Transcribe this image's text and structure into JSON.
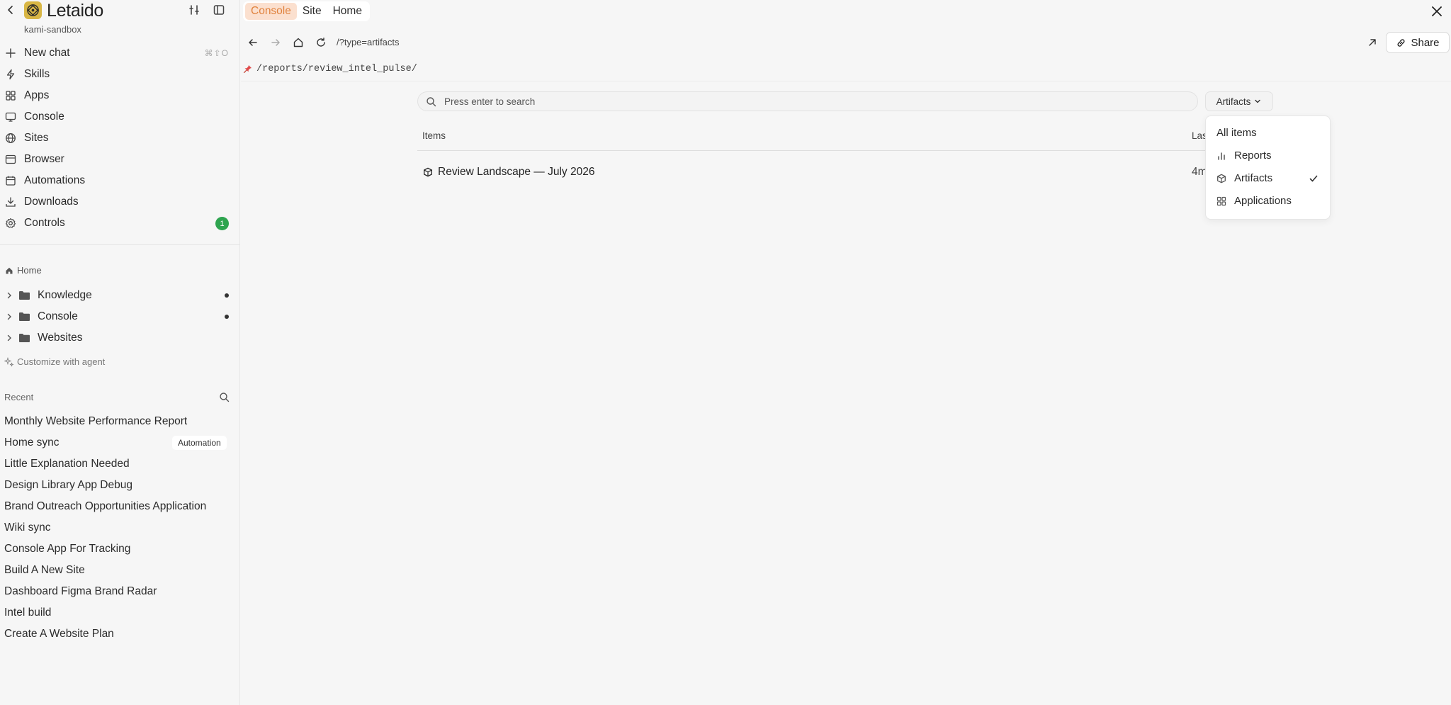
{
  "sidebar": {
    "brand": "Letaido",
    "workspace": "kami-sandbox",
    "nav": [
      {
        "label": "New chat",
        "icon": "plus-icon",
        "shortcut": "⌘⇧O"
      },
      {
        "label": "Skills",
        "icon": "bolt-icon"
      },
      {
        "label": "Apps",
        "icon": "grid-icon"
      },
      {
        "label": "Console",
        "icon": "monitor-icon"
      },
      {
        "label": "Sites",
        "icon": "globe-icon"
      },
      {
        "label": "Browser",
        "icon": "browser-icon"
      },
      {
        "label": "Automations",
        "icon": "calendar-icon"
      },
      {
        "label": "Downloads",
        "icon": "download-icon"
      },
      {
        "label": "Controls",
        "icon": "gear-icon",
        "badge": "1"
      }
    ],
    "home_label": "Home",
    "tree": [
      {
        "label": "Knowledge"
      },
      {
        "label": "Console"
      },
      {
        "label": "Websites"
      }
    ],
    "customize_label": "Customize with agent",
    "recent_label": "Recent",
    "recent": [
      {
        "label": "Monthly Website Performance Report"
      },
      {
        "label": "Home sync",
        "tag": "Automation"
      },
      {
        "label": "Little Explanation Needed"
      },
      {
        "label": "Design Library App Debug"
      },
      {
        "label": "Brand Outreach Opportunities Application"
      },
      {
        "label": "Wiki sync"
      },
      {
        "label": "Console App For Tracking"
      },
      {
        "label": "Build A New Site"
      },
      {
        "label": "Dashboard Figma Brand Radar"
      },
      {
        "label": "Intel build"
      },
      {
        "label": "Create A Website Plan"
      }
    ]
  },
  "topbar": {
    "tabs": [
      {
        "label": "Console",
        "active": true
      },
      {
        "label": "Site"
      },
      {
        "label": "Home"
      }
    ]
  },
  "urlbar": {
    "url": "/?type=artifacts",
    "share_label": "Share"
  },
  "path": "/reports/review_intel_pulse/",
  "search": {
    "placeholder": "Press enter to search"
  },
  "filter": {
    "label": "Artifacts"
  },
  "table": {
    "col_items": "Items",
    "col_last": "Las",
    "rows": [
      {
        "label": "Review Landscape — July 2026",
        "time": "4m"
      }
    ]
  },
  "dropdown": {
    "items": [
      {
        "label": "All items"
      },
      {
        "label": "Reports",
        "icon": "bar-chart-icon"
      },
      {
        "label": "Artifacts",
        "icon": "cube-icon",
        "selected": true
      },
      {
        "label": "Applications",
        "icon": "grid-icon"
      }
    ]
  },
  "colors": {
    "accent": "#e0823d",
    "accent_bg": "#fbe0cf",
    "badge": "#2ea44f",
    "brand_logo": "#d8b645"
  }
}
